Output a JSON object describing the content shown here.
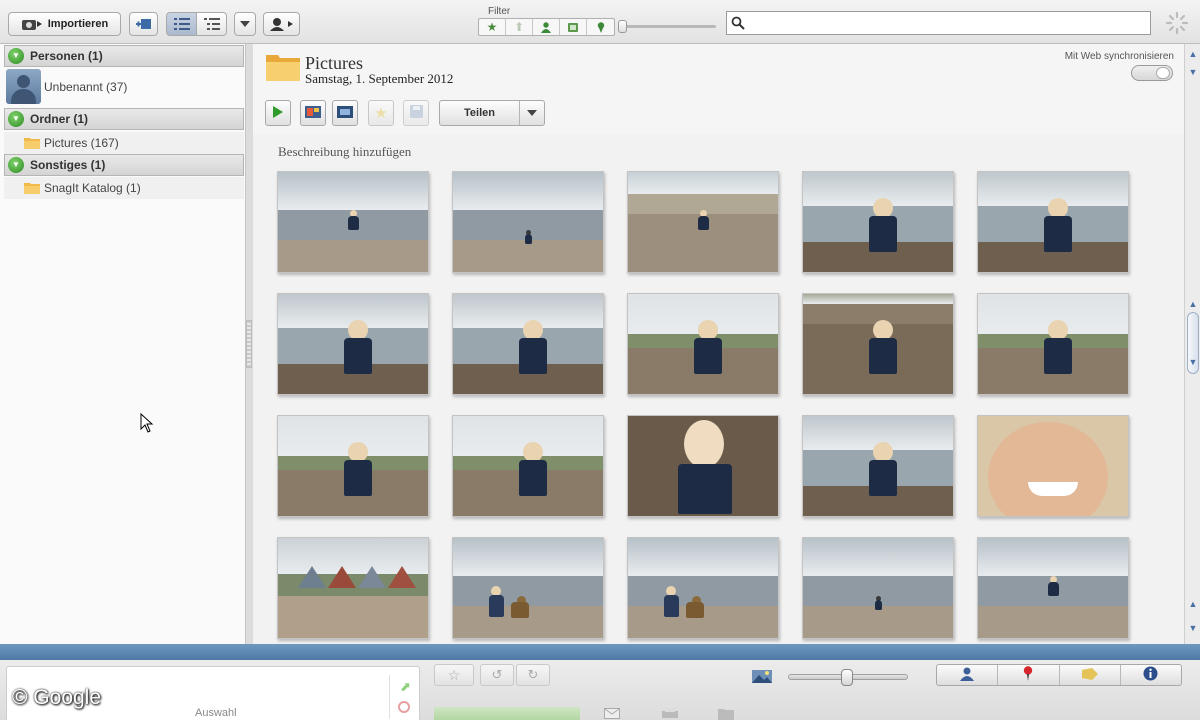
{
  "toolbar": {
    "import_label": "Importieren",
    "filter_label": "Filter",
    "filter_icons": [
      "star-icon",
      "arrow-up-icon",
      "person-icon",
      "film-icon",
      "map-pin-icon"
    ],
    "search": {
      "value": "",
      "placeholder": ""
    }
  },
  "sidebar": {
    "sections": [
      {
        "label": "Personen (1)",
        "items": [
          {
            "label": "Unbenannt (37)"
          }
        ]
      },
      {
        "label": "Ordner (1)",
        "items": [
          {
            "label": "Pictures (167)"
          }
        ]
      },
      {
        "label": "Sonstiges (1)",
        "items": [
          {
            "label": "SnagIt Katalog (1)"
          }
        ]
      }
    ]
  },
  "album": {
    "title": "Pictures",
    "date": "Samstag, 1. September 2012",
    "sync_label": "Mit Web synchronisieren",
    "share_label": "Teilen",
    "description_placeholder": "Beschreibung hinzufügen"
  },
  "photos": [
    {
      "scene": "beach",
      "kid": "small"
    },
    {
      "scene": "beach",
      "kid": "tiny"
    },
    {
      "scene": "dunes",
      "kid": "small"
    },
    {
      "scene": "shore",
      "kid": "big"
    },
    {
      "scene": "shore",
      "kid": "big"
    },
    {
      "scene": "shore",
      "kid": "big"
    },
    {
      "scene": "shore",
      "kid": "big"
    },
    {
      "scene": "field",
      "kid": "big"
    },
    {
      "scene": "ground",
      "kid": "big"
    },
    {
      "scene": "field",
      "kid": "big"
    },
    {
      "scene": "field",
      "kid": "big"
    },
    {
      "scene": "field",
      "kid": "big"
    },
    {
      "scene": "closeup",
      "kid": "face"
    },
    {
      "scene": "shore",
      "kid": "big"
    },
    {
      "scene": "portrait",
      "kid": "woman"
    },
    {
      "scene": "houses",
      "kid": "none"
    },
    {
      "scene": "beach",
      "kid": "pair"
    },
    {
      "scene": "beach",
      "kid": "pair"
    },
    {
      "scene": "beach",
      "kid": "tiny"
    },
    {
      "scene": "beach",
      "kid": "small"
    }
  ],
  "tray": {
    "label": "Auswahl",
    "watermark": "© Google"
  },
  "colors": {
    "accent_blue": "#4d7aa6",
    "green": "#2e8a23"
  }
}
